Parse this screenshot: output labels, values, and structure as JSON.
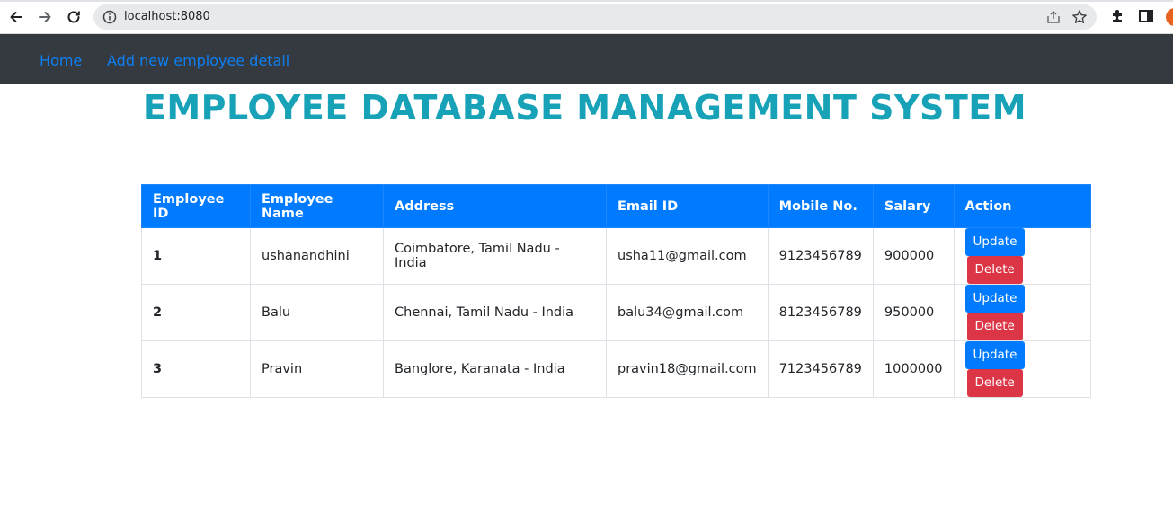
{
  "browser": {
    "url": "localhost:8080",
    "icons": [
      "back-icon",
      "forward-icon",
      "reload-icon",
      "info-icon",
      "share-icon",
      "bookmark-star-icon",
      "extensions-icon",
      "sidebar-icon",
      "profile-avatar"
    ]
  },
  "navbar": {
    "links": [
      "Home",
      "Add new employee detail"
    ]
  },
  "page": {
    "title": "EMPLOYEE DATABASE MANAGEMENT SYSTEM"
  },
  "table": {
    "headers": [
      "Employee ID",
      "Employee Name",
      "Address",
      "Email ID",
      "Mobile No.",
      "Salary",
      "Action"
    ],
    "rows": [
      {
        "id": "1",
        "name": "ushanandhini",
        "address": "Coimbatore, Tamil Nadu - India",
        "email": "usha11@gmail.com",
        "mobile": "9123456789",
        "salary": "900000"
      },
      {
        "id": "2",
        "name": "Balu",
        "address": "Chennai, Tamil Nadu - India",
        "email": "balu34@gmail.com",
        "mobile": "8123456789",
        "salary": "950000"
      },
      {
        "id": "3",
        "name": "Pravin",
        "address": "Banglore, Karanata - India",
        "email": "pravin18@gmail.com",
        "mobile": "7123456789",
        "salary": "1000000"
      }
    ],
    "update_label": "Update",
    "delete_label": "Delete"
  },
  "colors": {
    "navbar_bg": "#343a40",
    "link": "#007bff",
    "title": "#17a2b8",
    "header_bg": "#007bff",
    "update_btn": "#007bff",
    "delete_btn": "#dc3545"
  }
}
